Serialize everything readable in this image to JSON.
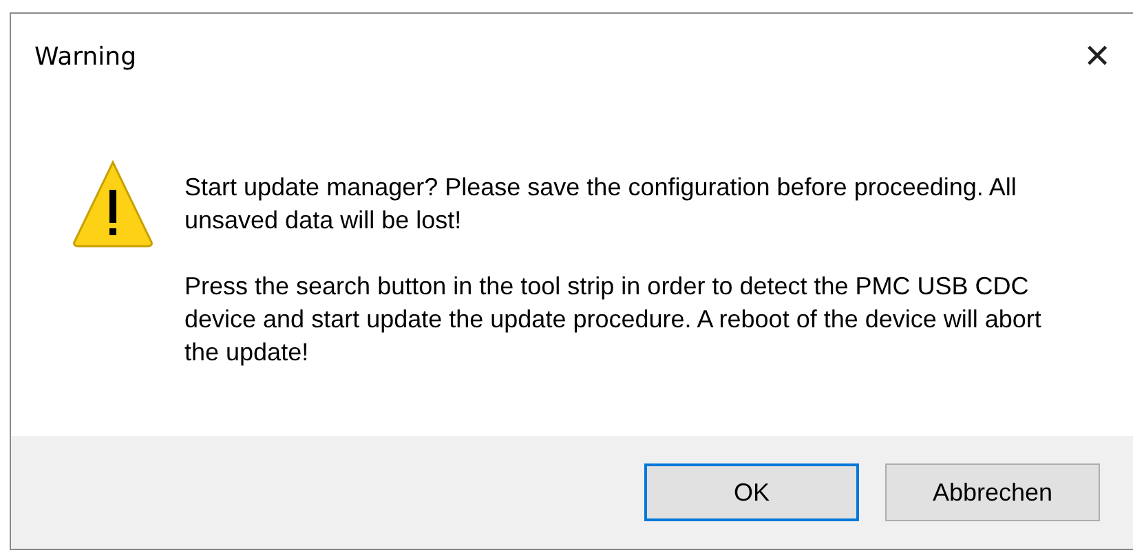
{
  "window": {
    "title": "Warning",
    "close": "✕"
  },
  "message": {
    "paragraphs": [
      "Start update manager? Please save the configuration before proceeding. All unsaved data will be lost!",
      "Press the search button in the tool strip in order to detect the PMC USB CDC device and start update the update procedure. A reboot of the device will abort the update!"
    ]
  },
  "buttons": [
    {
      "label": "OK",
      "default": true
    },
    {
      "label": "Abbrechen",
      "default": false
    }
  ]
}
